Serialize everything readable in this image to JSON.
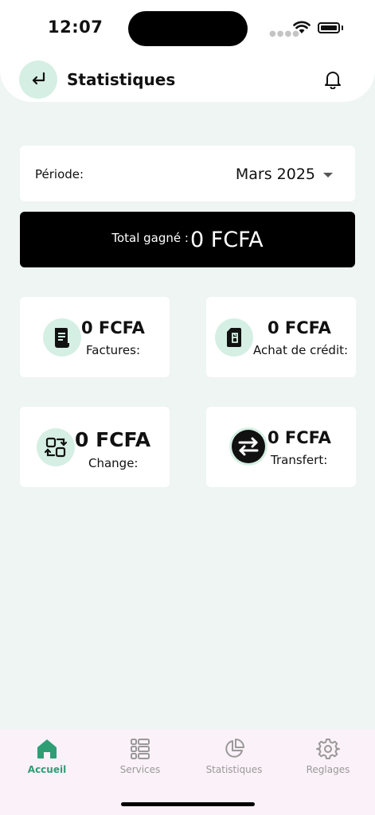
{
  "status_bar": {
    "time": "12:07"
  },
  "header": {
    "title": "Statistiques",
    "back_icon": "return-arrow-icon",
    "notification_icon": "bell-icon"
  },
  "period": {
    "label": "Période:",
    "value": "Mars 2025"
  },
  "total": {
    "label": "Total gagné :",
    "value": "0 FCFA"
  },
  "stats": [
    {
      "value": "0 FCFA",
      "label": "Factures:",
      "icon": "invoice-icon"
    },
    {
      "value": "0 FCFA",
      "label": "Achat de crédit:",
      "icon": "sim-card-icon"
    },
    {
      "value": "0 FCFA",
      "label": "Change:",
      "icon": "exchange-icon"
    },
    {
      "value": "0 FCFA",
      "label": "Transfert:",
      "icon": "transfer-icon"
    }
  ],
  "tabs": [
    {
      "label": "Accueil",
      "icon": "home-icon",
      "active": true
    },
    {
      "label": "Services",
      "icon": "services-icon",
      "active": false
    },
    {
      "label": "Statistiques",
      "icon": "pie-chart-icon",
      "active": false
    },
    {
      "label": "Reglages",
      "icon": "gear-icon",
      "active": false
    }
  ],
  "colors": {
    "accent": "#2f9e75",
    "icon_bg": "#d6efe4",
    "background": "#eef5f2",
    "tabbar": "#fbf1f8"
  }
}
